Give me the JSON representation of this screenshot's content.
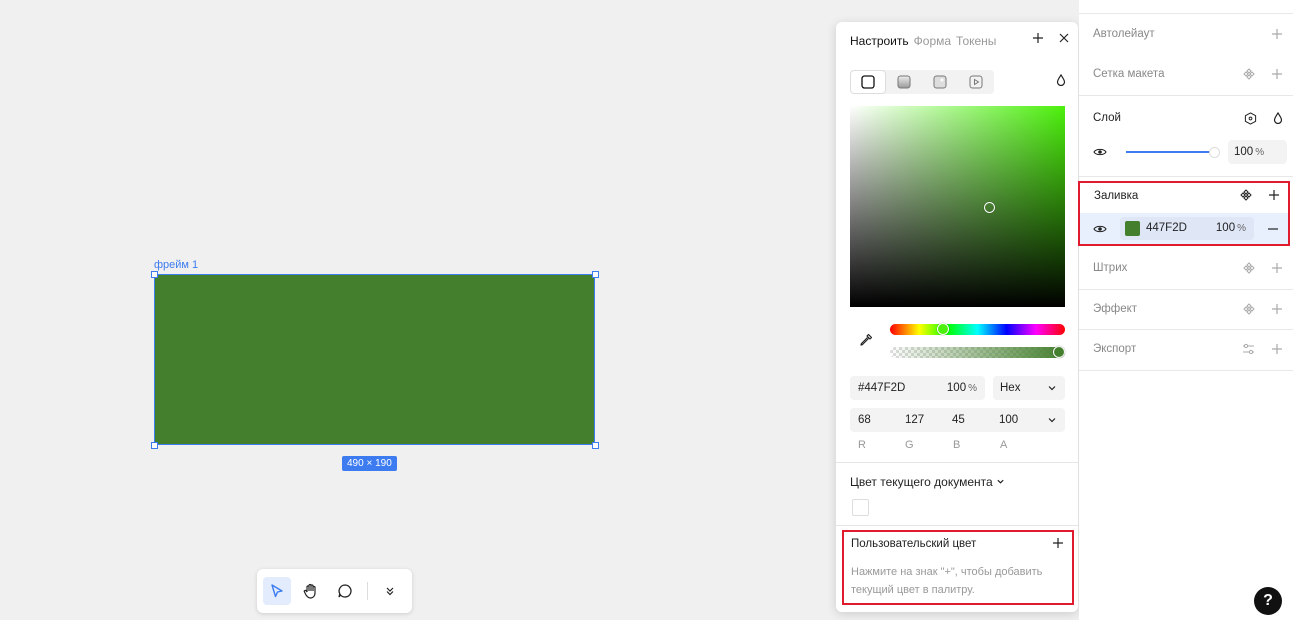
{
  "canvas": {
    "frame_label": "фрейм 1",
    "frame_size": "490 × 190",
    "frame_color": "#447F2D"
  },
  "toolbar": {
    "tools": [
      "select-icon",
      "hand-icon",
      "comment-icon",
      "chevron-double-down-icon"
    ]
  },
  "picker": {
    "tabs": [
      "Настроить",
      "Форма",
      "Токены"
    ],
    "active_tab": "Настроить",
    "fill_types": [
      "solid-fill-icon",
      "gradient-fill-icon",
      "image-fill-icon",
      "video-fill-icon"
    ],
    "hex": "#447F2D",
    "opacity": "100",
    "opacity_unit": "%",
    "format": "Hex",
    "r": "68",
    "g": "127",
    "b": "45",
    "a": "100",
    "labels": [
      "R",
      "G",
      "B",
      "A"
    ],
    "doc_colors_title": "Цвет текущего документа",
    "custom_title": "Пользовательский цвет",
    "custom_hint": "Нажмите на знак \"+\", чтобы добавить текущий цвет в палитру.",
    "accent": "#3D7CF0",
    "highlight": "#E01B2D"
  },
  "props": {
    "autolayout": "Автолейаут",
    "grid": "Сетка макета",
    "layer": "Слой",
    "layer_opacity": "100",
    "fill": "Заливка",
    "fill_hex": "447F2D",
    "fill_opacity": "100",
    "stroke": "Штрих",
    "effect": "Эффект",
    "export": "Экспорт"
  },
  "help": "?"
}
